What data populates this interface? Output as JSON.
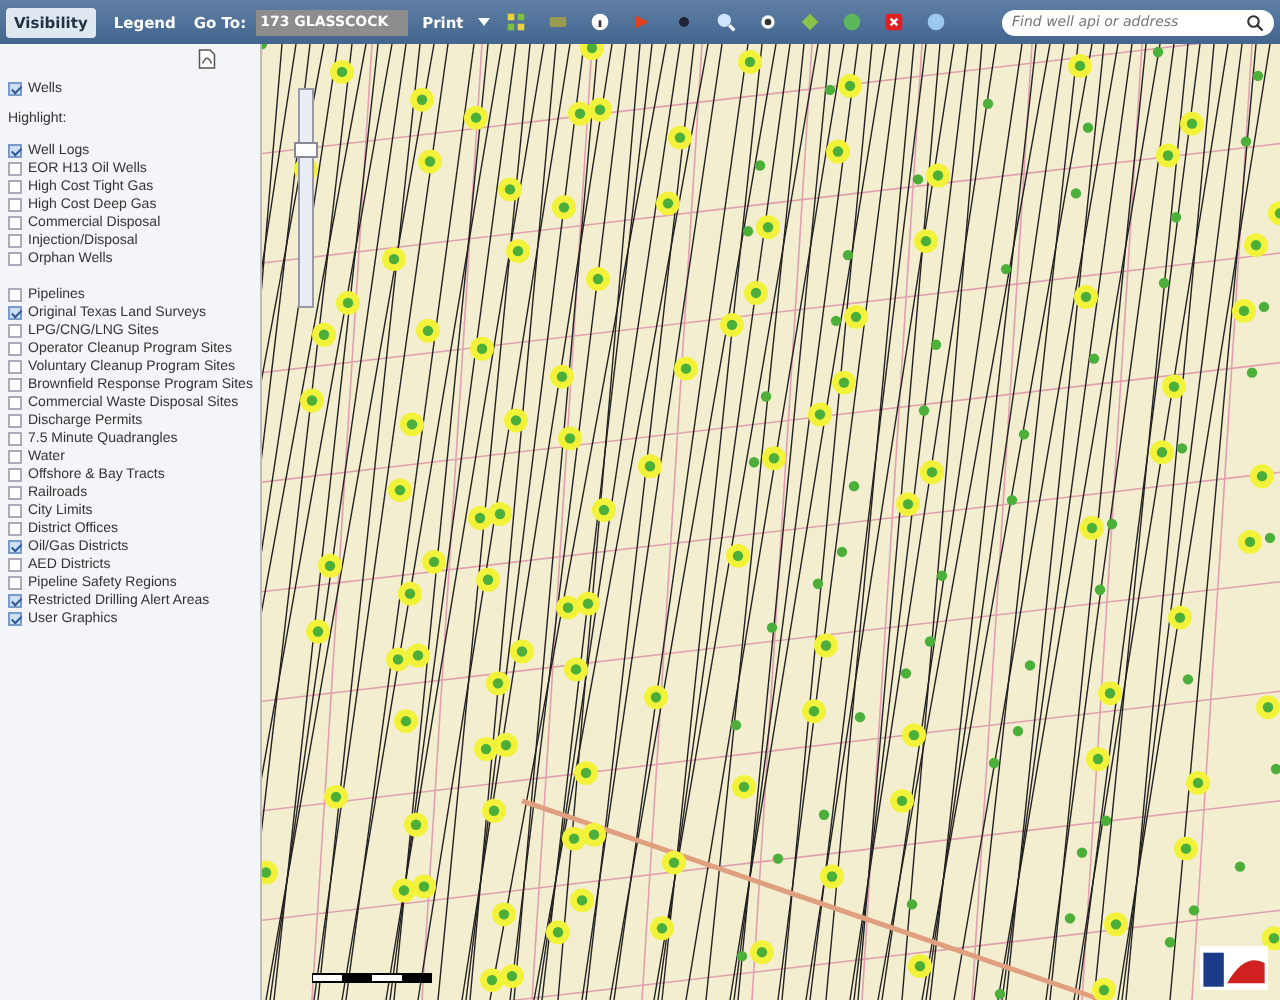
{
  "toolbar": {
    "tabs": [
      {
        "label": "Visibility",
        "selected": true
      },
      {
        "label": "Legend",
        "selected": false
      }
    ],
    "goto_label": "Go To:",
    "goto_value": "173 GLASSCOCK",
    "print_label": "Print",
    "search": {
      "placeholder": "Find well api or address"
    }
  },
  "map": {
    "zoom": {
      "level": 0.7
    }
  },
  "sidebar": {
    "wells": {
      "label": "Wells",
      "checked": true
    },
    "highlight_label": "Highlight:",
    "highlights": [
      {
        "label": "Well Logs",
        "checked": true
      },
      {
        "label": "EOR H13 Oil Wells",
        "checked": false
      },
      {
        "label": "High Cost Tight Gas",
        "checked": false
      },
      {
        "label": "High Cost Deep Gas",
        "checked": false
      },
      {
        "label": "Commercial Disposal",
        "checked": false
      },
      {
        "label": "Injection/Disposal",
        "checked": false
      },
      {
        "label": "Orphan Wells",
        "checked": false
      }
    ],
    "layers": [
      {
        "label": "Pipelines",
        "checked": false
      },
      {
        "label": "Original Texas Land Surveys",
        "checked": true
      },
      {
        "label": "LPG/CNG/LNG Sites",
        "checked": false
      },
      {
        "label": "Operator Cleanup Program Sites",
        "checked": false
      },
      {
        "label": "Voluntary Cleanup Program Sites",
        "checked": false
      },
      {
        "label": "Brownfield Response Program Sites",
        "checked": false
      },
      {
        "label": "Commercial Waste Disposal Sites",
        "checked": false
      },
      {
        "label": "Discharge Permits",
        "checked": false
      },
      {
        "label": "7.5 Minute Quadrangles",
        "checked": false
      },
      {
        "label": "Water",
        "checked": false
      },
      {
        "label": "Offshore & Bay Tracts",
        "checked": false
      },
      {
        "label": "Railroads",
        "checked": false
      },
      {
        "label": "City Limits",
        "checked": false
      },
      {
        "label": "District Offices",
        "checked": false
      },
      {
        "label": "Oil/Gas Districts",
        "checked": true
      },
      {
        "label": "AED Districts",
        "checked": false
      },
      {
        "label": "Pipeline Safety Regions",
        "checked": false
      },
      {
        "label": "Restricted Drilling Alert Areas",
        "checked": true
      },
      {
        "label": "User Graphics",
        "checked": true
      }
    ]
  }
}
